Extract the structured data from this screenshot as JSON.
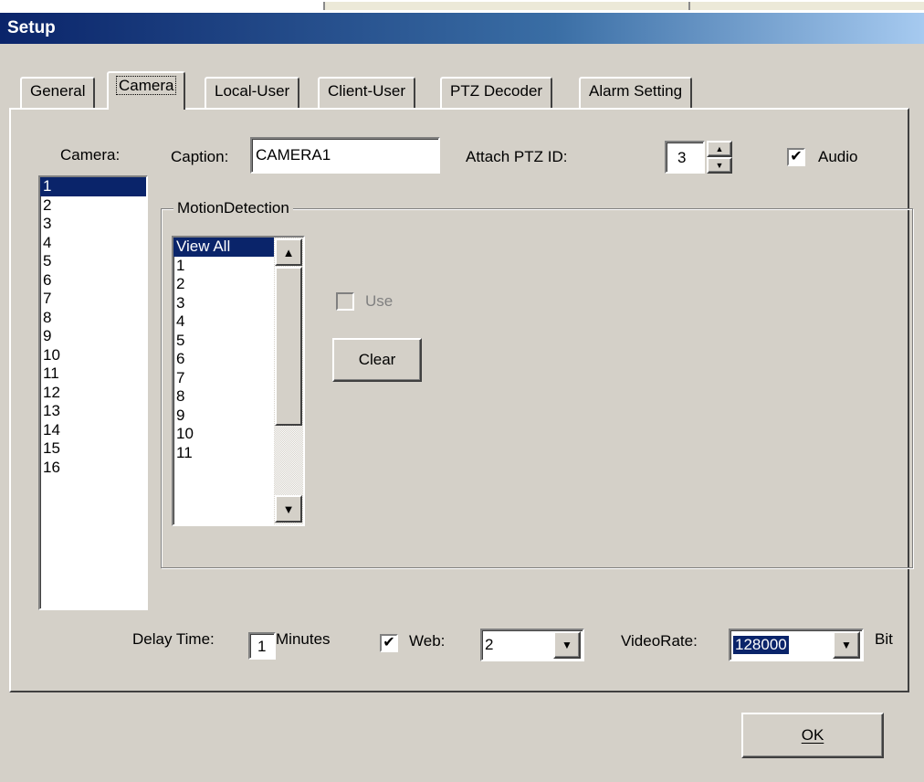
{
  "window": {
    "title": "Setup"
  },
  "tabs": [
    {
      "label": "General"
    },
    {
      "label": "Camera"
    },
    {
      "label": "Local-User"
    },
    {
      "label": "Client-User"
    },
    {
      "label": "PTZ Decoder"
    },
    {
      "label": "Alarm Setting"
    }
  ],
  "active_tab": "Camera",
  "camera_list": {
    "label": "Camera:",
    "items": [
      "1",
      "2",
      "3",
      "4",
      "5",
      "6",
      "7",
      "8",
      "9",
      "10",
      "11",
      "12",
      "13",
      "14",
      "15",
      "16"
    ],
    "selected": "1"
  },
  "caption": {
    "label": "Caption:",
    "value": "CAMERA1"
  },
  "ptz": {
    "label": "Attach PTZ ID:",
    "value": "3"
  },
  "audio": {
    "label": "Audio",
    "checked": true
  },
  "motion": {
    "group_label": "MotionDetection",
    "items": [
      "View All",
      "1",
      "2",
      "3",
      "4",
      "5",
      "6",
      "7",
      "8",
      "9",
      "10",
      "11"
    ],
    "selected": "View All",
    "use_label": "Use",
    "clear_label": "Clear"
  },
  "delay": {
    "label": "Delay Time:",
    "value": "1",
    "unit": "Minutes"
  },
  "web": {
    "label": "Web:",
    "checked": true,
    "value": "2"
  },
  "videorate": {
    "label": "VideoRate:",
    "value": "128000",
    "unit": "Bit"
  },
  "ok_label": "OK",
  "icons": {
    "check": "✔",
    "up": "▲",
    "down": "▼",
    "spin_up": "▲",
    "spin_down": "▼"
  },
  "colors": {
    "selection": "#0a246a",
    "face": "#d4d0c8"
  }
}
